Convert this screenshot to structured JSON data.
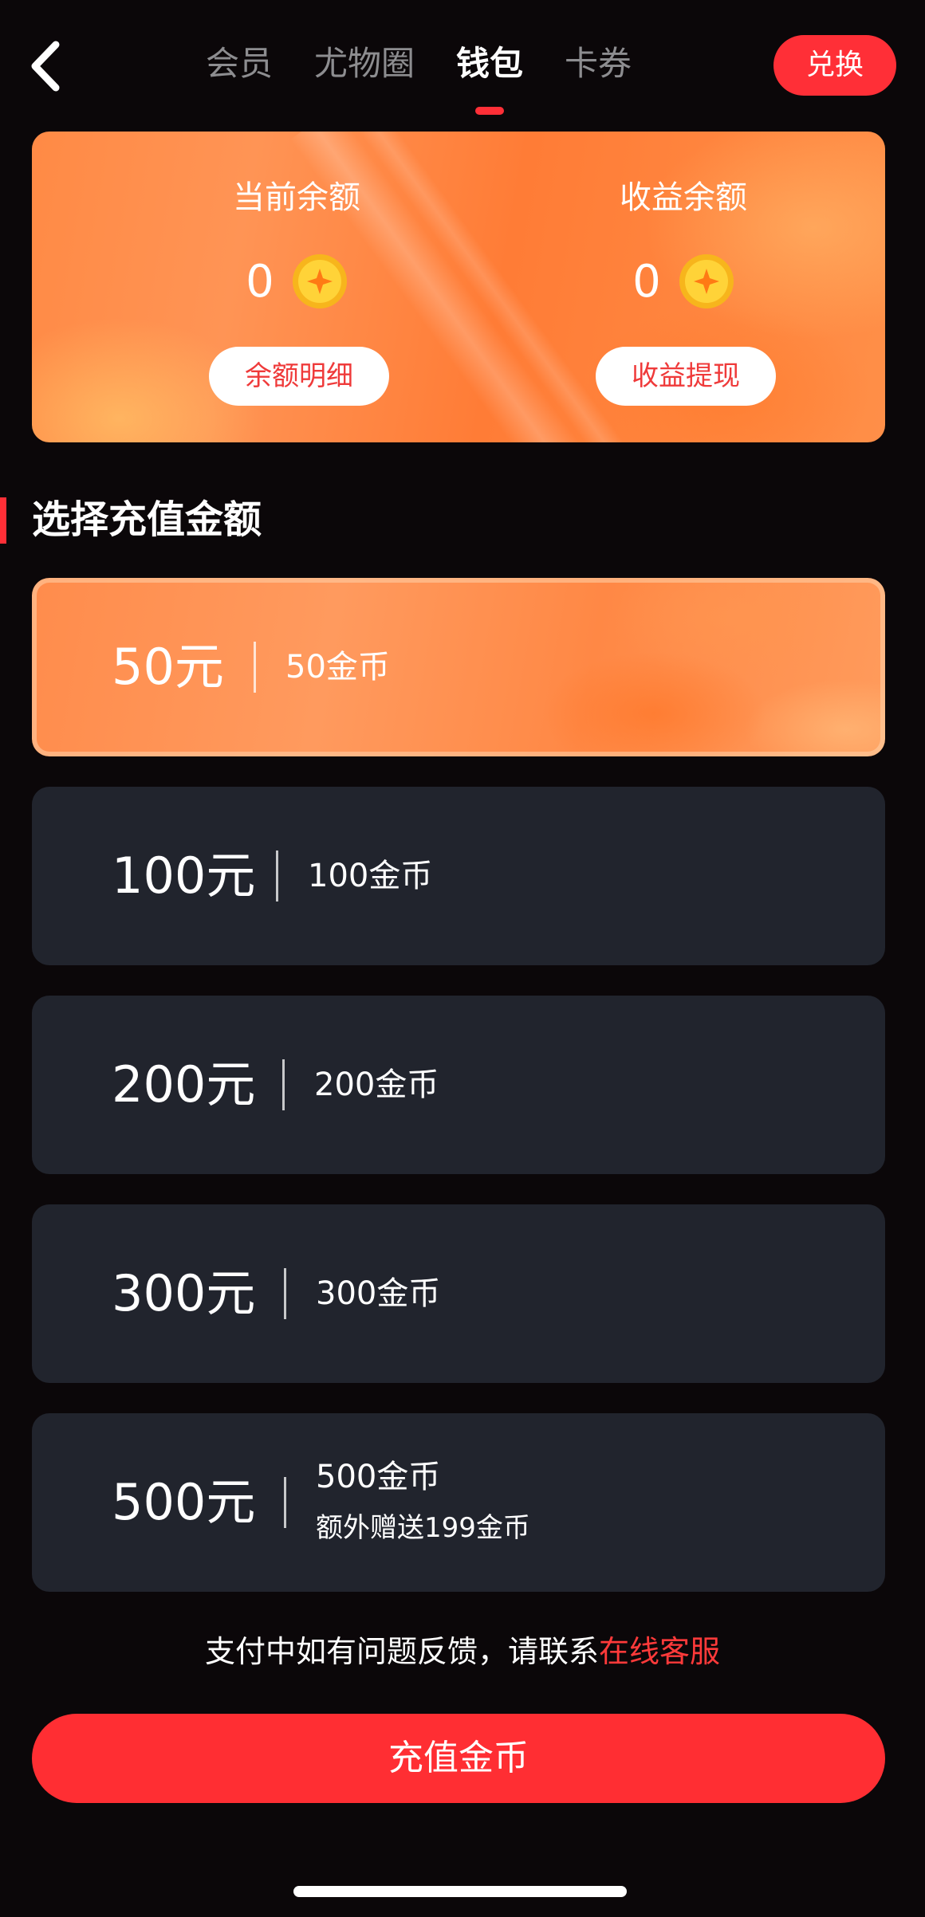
{
  "nav": {
    "tabs": [
      {
        "label": "会员",
        "active": false
      },
      {
        "label": "尤物圈",
        "active": false
      },
      {
        "label": "钱包",
        "active": true
      },
      {
        "label": "卡券",
        "active": false
      }
    ],
    "exchange_label": "兑换",
    "back_icon": "chevron-left-icon"
  },
  "balance_card": {
    "current": {
      "label": "当前余额",
      "value": "0",
      "button_label": "余额明细"
    },
    "earnings": {
      "label": "收益余额",
      "value": "0",
      "button_label": "收益提现"
    },
    "coin_icon": "gold-coin-icon"
  },
  "section": {
    "title": "选择充值金额"
  },
  "options": [
    {
      "price": "50元",
      "coins": "50金币",
      "selected": true
    },
    {
      "price": "100元",
      "coins": "100金币",
      "selected": false
    },
    {
      "price": "200元",
      "coins": "200金币",
      "selected": false
    },
    {
      "price": "300元",
      "coins": "300金币",
      "selected": false
    },
    {
      "price": "500元",
      "coins": "500金币",
      "bonus": "额外赠送199金币",
      "selected": false
    }
  ],
  "footer": {
    "help_text": "支付中如有问题反馈，请联系",
    "help_link": "在线客服",
    "recharge_label": "充值金币"
  },
  "colors": {
    "accent_red": "#ff2f37",
    "card_orange": "#ff8a45",
    "option_bg": "#21242d",
    "page_bg": "#0b0709"
  }
}
